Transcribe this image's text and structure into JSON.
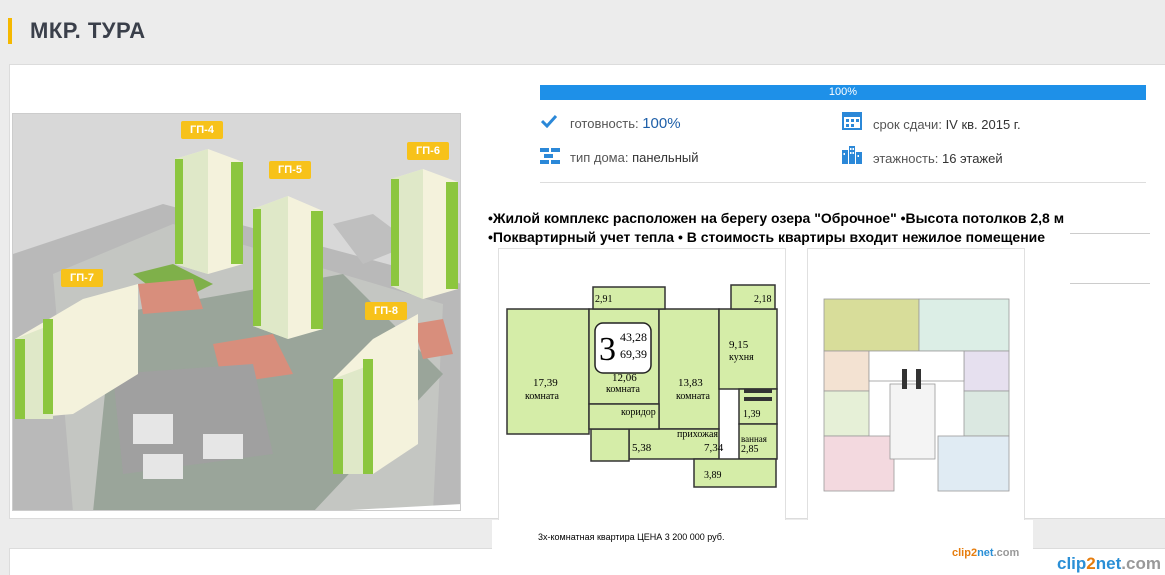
{
  "page": {
    "title": "МКР. ТУРА"
  },
  "progress": {
    "label": "100%",
    "value": 1.0
  },
  "info": {
    "readiness_label": "готовность:",
    "readiness_value": "100%",
    "deadline_label": "срок сдачи:",
    "deadline_value": "IV кв. 2015 г.",
    "house_type_label": "тип дома:",
    "house_type_value": "панельный",
    "floors_label": "этажность:",
    "floors_value": "16 этажей"
  },
  "notes": {
    "line1": "•Жилой комплекс расположен на берегу озера \"Оброчное\" •Высота потолков 2,8 м",
    "line2": "•Поквартирный учет тепла •   В стоимость квартиры входит нежилое помещение"
  },
  "buildings": [
    "ГП-4",
    "ГП-5",
    "ГП-6",
    "ГП-7",
    "ГП-8"
  ],
  "plan": {
    "rooms_count": "3",
    "living_area": "43,28",
    "total_area": "69,39",
    "room1_area": "17,39",
    "room1_label": "комната",
    "room2_area": "12,06",
    "room2_label": "комната",
    "room3_area": "13,83",
    "room3_label": "комната",
    "kitchen_area": "9,15",
    "kitchen_label": "кухня",
    "corridor_label": "коридор",
    "hall_label": "прихожая",
    "bath_label": "ванная",
    "balcony1": "2,91",
    "balcony2": "2,18",
    "a538": "5,38",
    "a734": "7,34",
    "a139": "1,39",
    "a285": "2,85",
    "a389": "3,89",
    "caption": "3х-комнатная квартира  ЦЕНА 3 200 000 руб."
  },
  "watermark": {
    "a": "clip",
    "b": "2",
    "c": "net",
    "d": ".com"
  },
  "colors": {
    "accent": "#f5b800",
    "progress": "#1e90e8",
    "plan_green": "#d5eda8",
    "building_green": "#8cc63f"
  }
}
